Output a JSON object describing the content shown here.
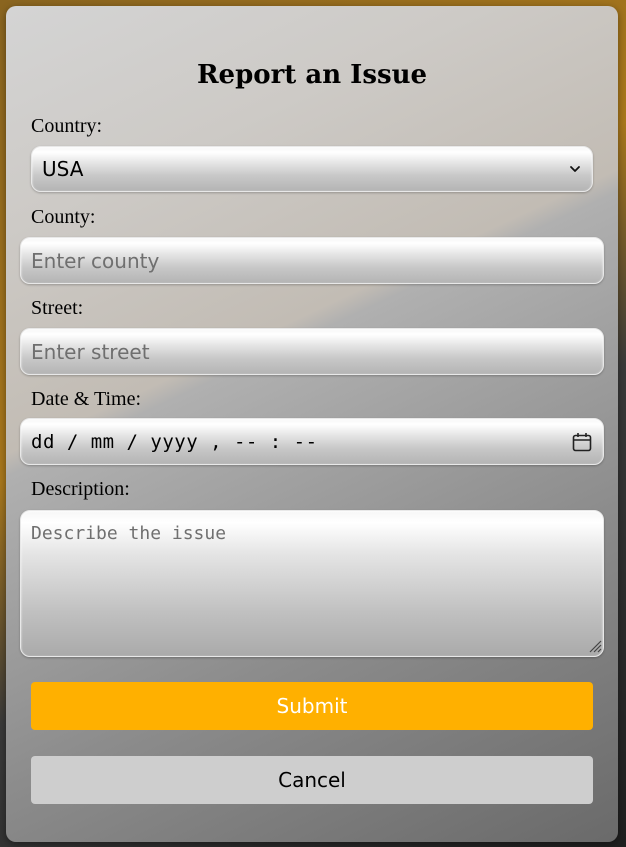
{
  "form": {
    "title": "Report an Issue",
    "country": {
      "label": "Country:",
      "selected": "USA"
    },
    "county": {
      "label": "County:",
      "placeholder": "Enter county",
      "value": ""
    },
    "street": {
      "label": "Street:",
      "placeholder": "Enter street",
      "value": ""
    },
    "datetime": {
      "label": "Date & Time:",
      "display": "dd / mm / yyyy ,  -- : --"
    },
    "description": {
      "label": "Description:",
      "placeholder": "Describe the issue",
      "value": ""
    },
    "submit_label": "Submit",
    "cancel_label": "Cancel"
  },
  "colors": {
    "submit_bg": "#ffb000",
    "cancel_bg": "#cecece",
    "backdrop_gold": "#a9781c"
  },
  "icons": {
    "select_chevron": "chevron-down-icon",
    "date_picker": "calendar-icon",
    "textarea_grip": "resize-grip-icon"
  }
}
